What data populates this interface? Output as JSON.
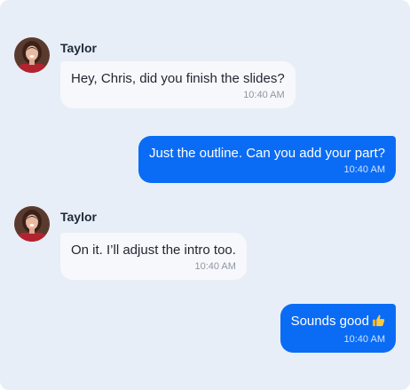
{
  "conversation": {
    "messages": [
      {
        "direction": "incoming",
        "sender": "Taylor",
        "text": "Hey, Chris, did you finish the slides?",
        "time": "10:40 AM"
      },
      {
        "direction": "outgoing",
        "text": "Just the outline. Can you add your part?",
        "time": "10:40 AM"
      },
      {
        "direction": "incoming",
        "sender": "Taylor",
        "text": "On it. I’ll adjust the intro too.",
        "time": "10:40 AM"
      },
      {
        "direction": "outgoing",
        "text": "Sounds good",
        "emoji": "thumbs-up-emoji",
        "time": "10:40 AM"
      }
    ]
  },
  "colors": {
    "panel_background": "#e8eef7",
    "incoming_bubble": "#f7f8fb",
    "outgoing_bubble": "#0a6cf5",
    "outgoing_text": "#ffffff"
  }
}
